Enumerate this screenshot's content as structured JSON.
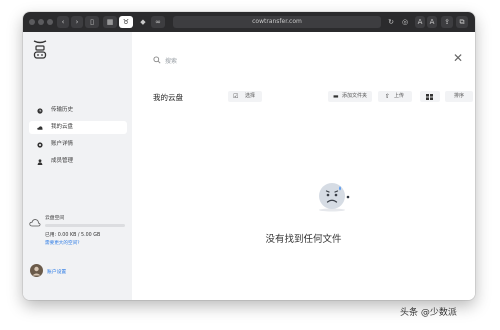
{
  "browser": {
    "url": "cowtransfer.com",
    "toolbar_right": [
      "A",
      "A"
    ]
  },
  "sidebar": {
    "nav": [
      {
        "label": "传输历史",
        "icon": "clock-icon"
      },
      {
        "label": "我的云盘",
        "icon": "cloud-drive-icon",
        "active": true
      },
      {
        "label": "账户详情",
        "icon": "account-icon"
      },
      {
        "label": "成员管理",
        "icon": "members-icon"
      }
    ],
    "storage": {
      "label": "云盘空间",
      "used_text": "已用: 0.00 KB / 5.00 GB",
      "upgrade_link": "需要更大的空间?",
      "fraction_used": 0
    },
    "account": {
      "label": "账户设置"
    }
  },
  "main": {
    "search_placeholder": "搜索",
    "title": "我的云盘",
    "select_label": "选择",
    "new_folder_label": "添加文件夹",
    "upload_label": "上传",
    "sort_label": "排序",
    "empty_message": "没有找到任何文件"
  },
  "watermark": "头条 @少数派"
}
